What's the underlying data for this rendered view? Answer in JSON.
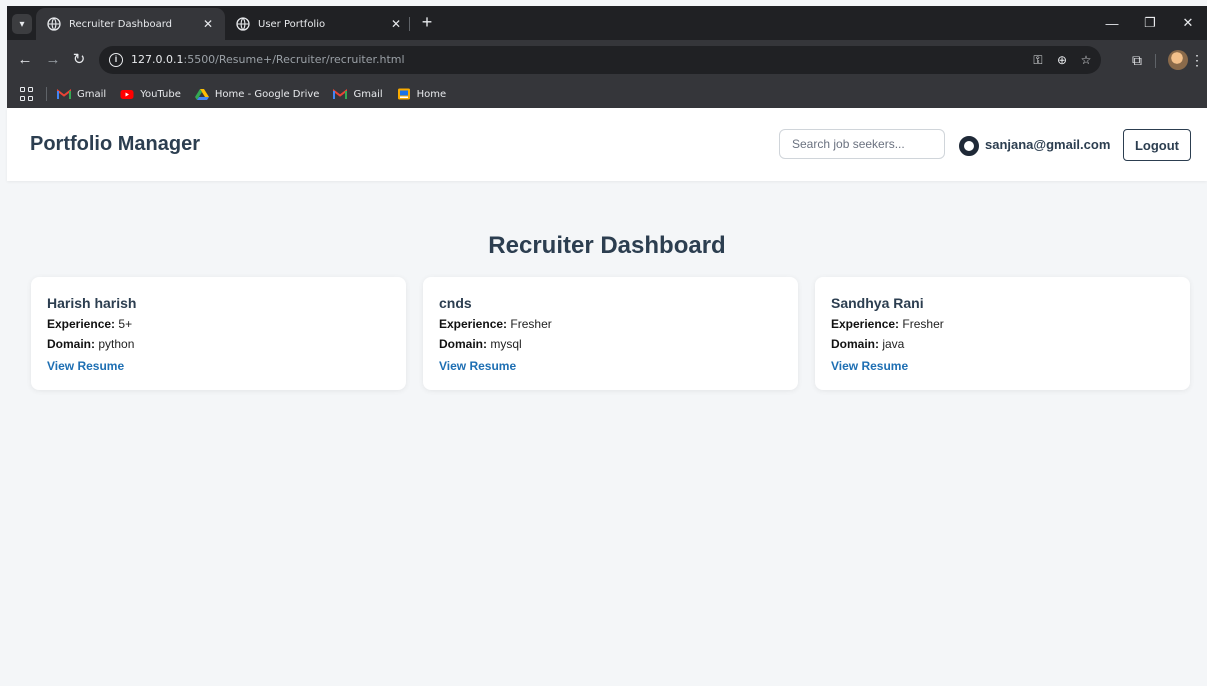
{
  "browser": {
    "tabs": [
      {
        "title": "Recruiter Dashboard",
        "active": true
      },
      {
        "title": "User Portfolio",
        "active": false
      }
    ],
    "url_host": "127.0.0.1",
    "url_path": ":5500/Resume+/Recruiter/recruiter.html",
    "bookmarks": [
      {
        "label": "Gmail",
        "icon": "gmail-icon"
      },
      {
        "label": "YouTube",
        "icon": "youtube-icon"
      },
      {
        "label": "Home - Google Drive",
        "icon": "google-drive-icon"
      },
      {
        "label": "Gmail",
        "icon": "gmail-icon"
      },
      {
        "label": "Home",
        "icon": "home-bookmark-icon"
      }
    ]
  },
  "navbar": {
    "brand": "Portfolio Manager",
    "search_placeholder": "Search job seekers...",
    "user_email": "sanjana@gmail.com",
    "logout_label": "Logout"
  },
  "main": {
    "title": "Recruiter Dashboard",
    "experience_label": "Experience:",
    "domain_label": "Domain:",
    "view_resume_label": "View Resume",
    "cards": [
      {
        "name": "Harish harish",
        "experience": "5+",
        "domain": "python"
      },
      {
        "name": "cnds",
        "experience": "Fresher",
        "domain": "mysql"
      },
      {
        "name": "Sandhya Rani",
        "experience": "Fresher",
        "domain": "java"
      }
    ]
  },
  "colors": {
    "brand_text": "#2c3e50",
    "link": "#1e6fb3",
    "page_bg": "#f4f6f8",
    "chrome_bg": "#202124"
  }
}
